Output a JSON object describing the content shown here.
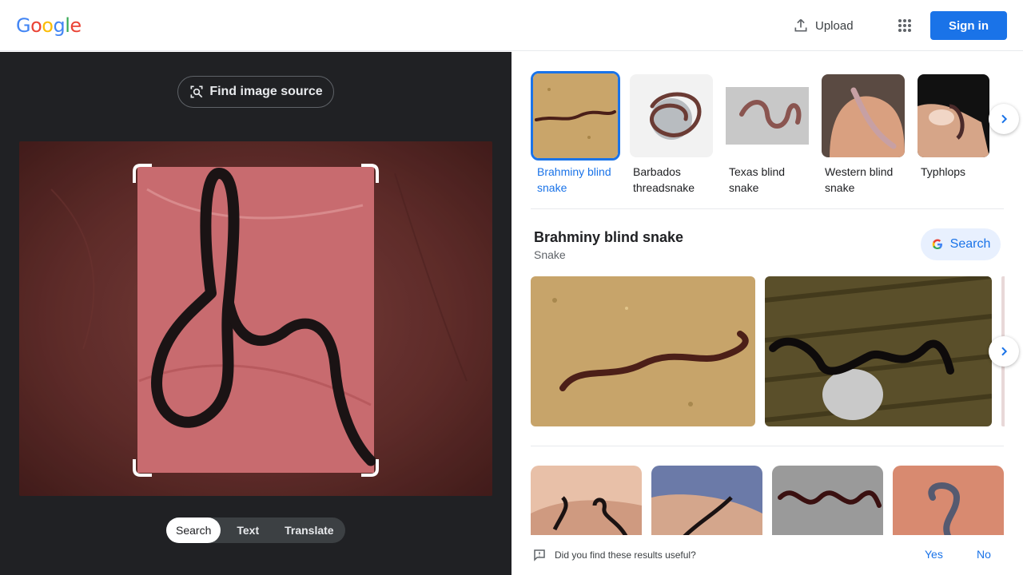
{
  "header": {
    "logo": {
      "letters": [
        "G",
        "o",
        "o",
        "g",
        "l",
        "e"
      ],
      "colors": [
        "#4285f4",
        "#ea4335",
        "#fbbc05",
        "#4285f4",
        "#34a853",
        "#ea4335"
      ]
    },
    "upload_label": "Upload",
    "upload_icon": "upload-icon",
    "apps_icon": "apps-grid-icon",
    "signin_label": "Sign in"
  },
  "left_panel": {
    "find_source_label": "Find image source",
    "find_source_icon": "lens-search-icon",
    "mode_tabs": [
      {
        "label": "Search",
        "active": true
      },
      {
        "label": "Text",
        "active": false
      },
      {
        "label": "Translate",
        "active": false
      }
    ]
  },
  "right_panel": {
    "entities": [
      {
        "label": "Brahminy blind snake",
        "selected": true
      },
      {
        "label": "Barbados threadsnake",
        "selected": false
      },
      {
        "label": "Texas blind snake",
        "selected": false
      },
      {
        "label": "Western blind snake",
        "selected": false
      },
      {
        "label": "Typhlops",
        "selected": false
      }
    ],
    "knowledge": {
      "title": "Brahminy blind snake",
      "subtitle": "Snake",
      "search_label": "Search"
    },
    "feedback": {
      "question": "Did you find these results useful?",
      "yes": "Yes",
      "no": "No"
    }
  },
  "colors": {
    "accent": "#1a73e8",
    "dark_panel": "#202124"
  }
}
